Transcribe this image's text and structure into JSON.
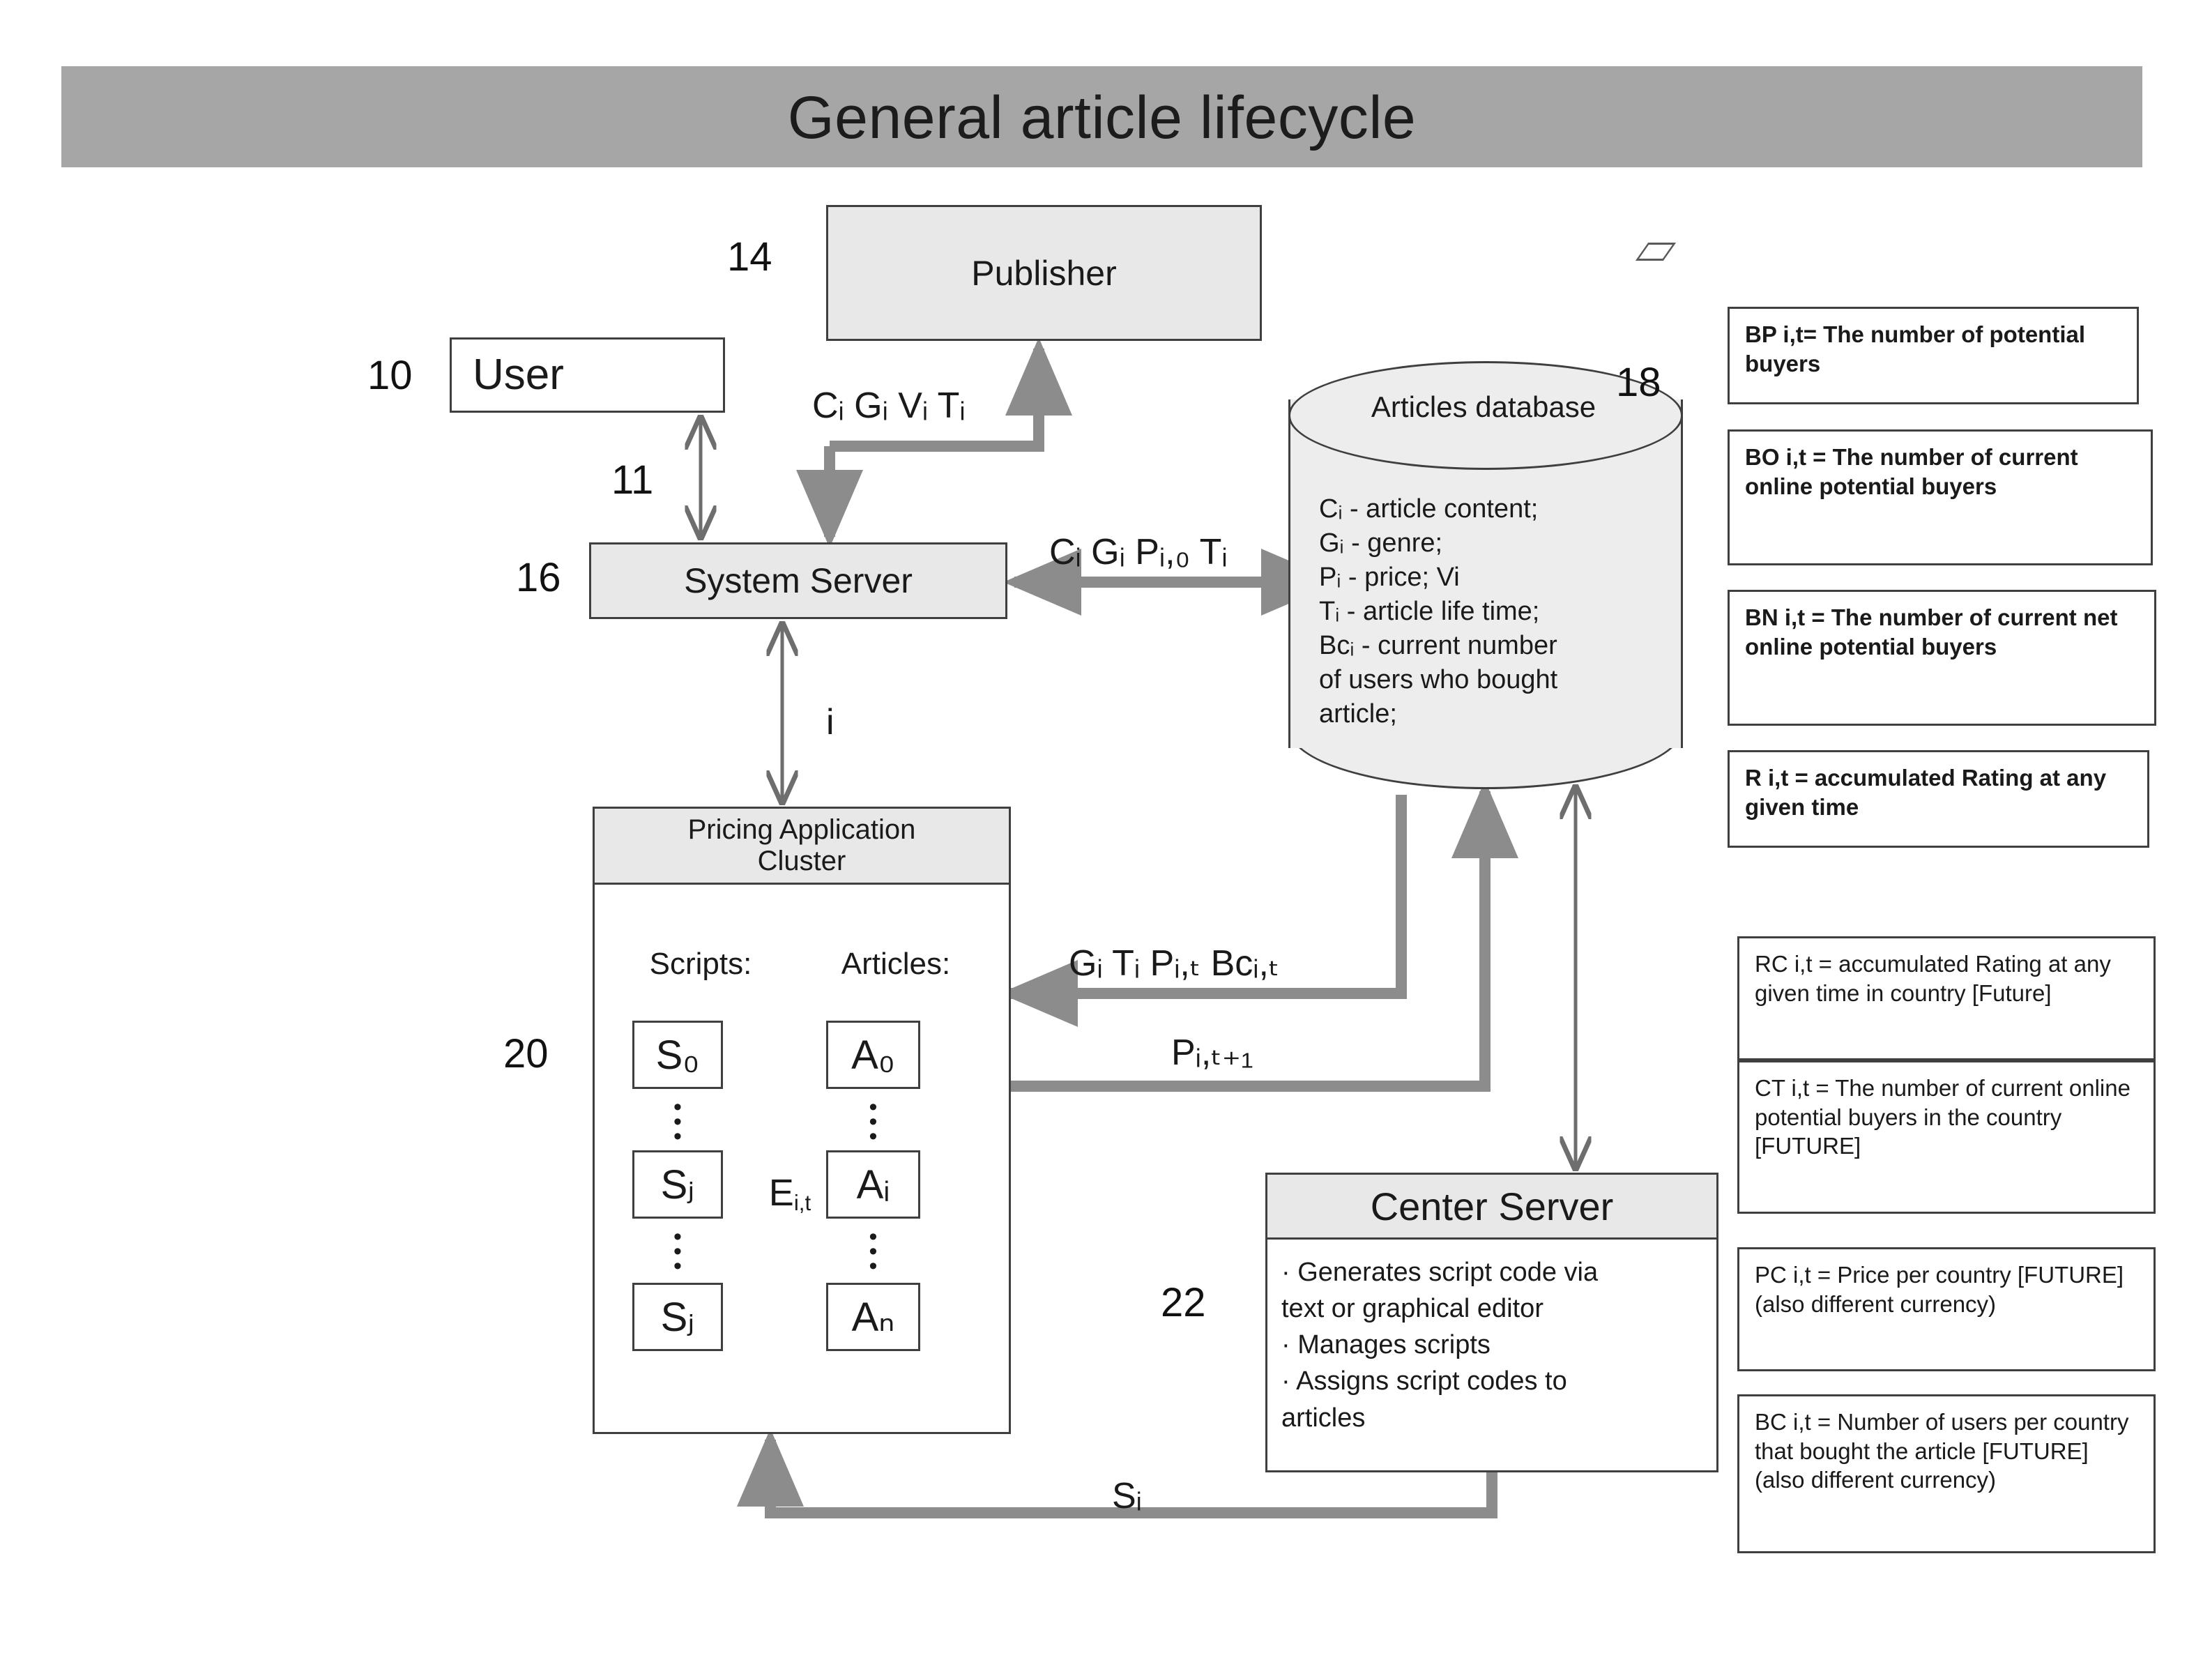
{
  "header": {
    "title": "General article lifecycle"
  },
  "nodes": {
    "user": {
      "label": "User",
      "ref": "10"
    },
    "publisher": {
      "label": "Publisher",
      "ref": "14"
    },
    "system_server": {
      "label": "System Server",
      "ref": "16"
    },
    "user_link_ref": "11",
    "database": {
      "ref": "18",
      "title": "Articles database",
      "fields": [
        "Cᵢ - article content;",
        "Gᵢ - genre;",
        "Pᵢ - price;  Vi",
        "Tᵢ - article life time;",
        "Bcᵢ - current number",
        "of users who bought",
        "article;"
      ]
    },
    "cluster": {
      "ref": "20",
      "title_line1": "Pricing Application",
      "title_line2": "Cluster",
      "scripts_label": "Scripts:",
      "articles_label": "Articles:",
      "scripts": [
        "S₀",
        "Sⱼ",
        "Sⱼ"
      ],
      "script_labels": [
        "S0",
        "Sj",
        "SJ"
      ],
      "articles": [
        "A₀",
        "Aᵢ",
        "Aₙ"
      ],
      "exchange_label": "E",
      "exchange_sub": "i,t",
      "dots": "•\n•\n•"
    },
    "center_server": {
      "ref": "22",
      "title": "Center Server",
      "bullets": [
        "· Generates script code via",
        "text or graphical editor",
        "· Manages scripts",
        "· Assigns script codes to",
        "articles"
      ]
    }
  },
  "arrow_labels": {
    "user_to_publisher": "Cᵢ Gᵢ Vᵢ Tᵢ",
    "server_to_db": "Cᵢ Gᵢ Pᵢ,₀ Tᵢ",
    "db_to_cluster": "Gᵢ Tᵢ Pᵢ,ₜ Bcᵢ,ₜ",
    "cluster_to_db": "Pᵢ,ₜ₊₁",
    "server_cluster": "i",
    "center_to_cluster": "Sᵢ"
  },
  "legend": [
    {
      "id": "BP",
      "text": "BP i,t= The number of potential buyers",
      "bold": true
    },
    {
      "id": "BO",
      "text": "BO i,t = The number of current online potential buyers",
      "bold": true
    },
    {
      "id": "BN",
      "text": "BN i,t = The number of current net online potential buyers",
      "bold": true
    },
    {
      "id": "R",
      "text": "R i,t = accumulated Rating at any given time",
      "bold": true
    },
    {
      "id": "RC",
      "text": "RC  i,t = accumulated Rating at any given time in country [Future]",
      "bold": false
    },
    {
      "id": "CT",
      "text": "CT i,t = The number of current online potential buyers in the country [FUTURE]",
      "bold": false
    },
    {
      "id": "PC",
      "text": "PC i,t = Price per country [FUTURE]  (also different currency)",
      "bold": false
    },
    {
      "id": "BC",
      "text": "BC i,t = Number of users per country that bought the article [FUTURE]  (also different currency)",
      "bold": false
    }
  ],
  "colors": {
    "title_bar": "#a6a6a6",
    "box_fill": "#e8e8e8",
    "db_fill": "#ededed",
    "stroke": "#3f3f3f",
    "thick_arrow": "#8c8c8c",
    "thin_arrow": "#808080"
  }
}
